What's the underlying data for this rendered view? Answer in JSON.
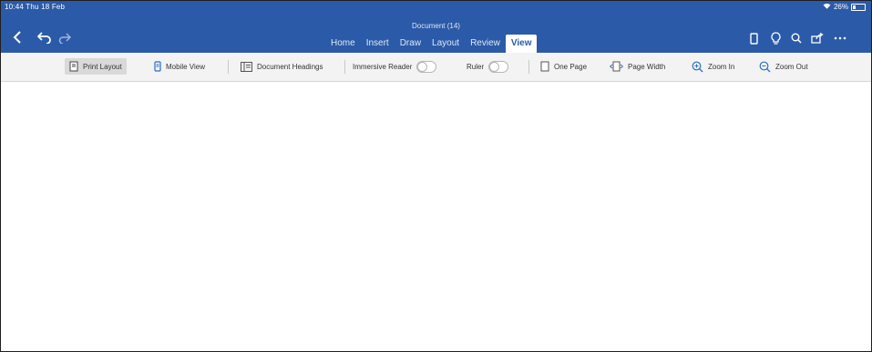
{
  "status_bar": {
    "time": "10:44 Thu 18 Feb",
    "battery": "26%"
  },
  "title_bar": {
    "document_title": "Document (14)"
  },
  "tabs": [
    {
      "label": "Home",
      "active": false
    },
    {
      "label": "Insert",
      "active": false
    },
    {
      "label": "Draw",
      "active": false
    },
    {
      "label": "Layout",
      "active": false
    },
    {
      "label": "Review",
      "active": false
    },
    {
      "label": "View",
      "active": true
    }
  ],
  "ribbon": {
    "print_layout": "Print Layout",
    "mobile_view": "Mobile View",
    "document_headings": "Document Headings",
    "immersive_reader": "Immersive Reader",
    "ruler": "Ruler",
    "one_page": "One Page",
    "page_width": "Page Width",
    "zoom_in": "Zoom In",
    "zoom_out": "Zoom Out"
  },
  "colors": {
    "title_bar": "#2b5aa8",
    "ribbon_bg": "#f3f3f3",
    "accent_icon": "#2b6cc4"
  }
}
